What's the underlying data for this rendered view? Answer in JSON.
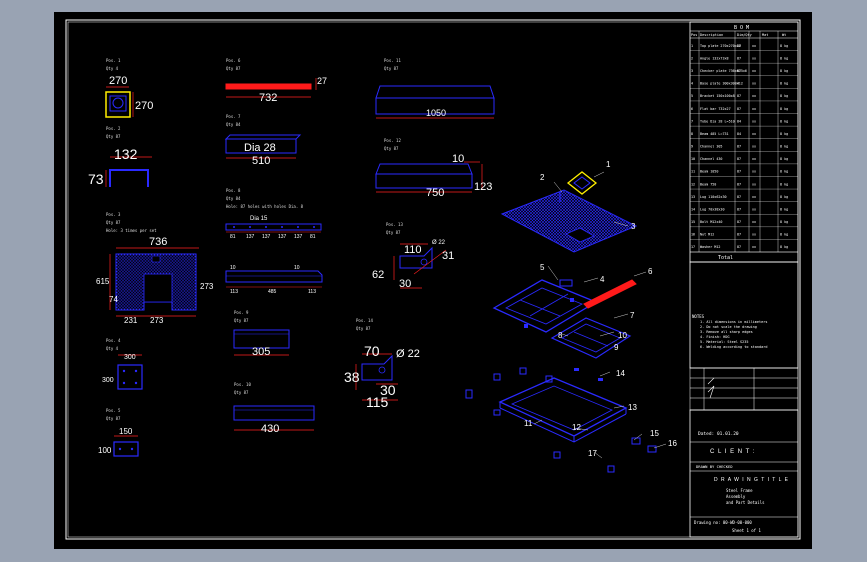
{
  "colors": {
    "background": "#000000",
    "border": "#ffffff",
    "part": "#1a1aff",
    "red": "#ff1a1a",
    "dim": "#ff2020",
    "yellow": "#ffee00",
    "text": "#ffffff"
  },
  "parts": {
    "p1": {
      "name": "Pos. 1",
      "qty": "Qty 4",
      "w": "270",
      "h": "270"
    },
    "p2": {
      "name": "Pos. 2",
      "qty": "Qty 87",
      "w": "132",
      "h": "73"
    },
    "p3": {
      "name": "Pos. 3",
      "qty": "Qty 87",
      "note": "Hole: 3 times per set",
      "w": "736",
      "h": "615",
      "d1": "273",
      "d2": "74",
      "d3": "231",
      "d4": "273"
    },
    "p4": {
      "name": "Pos. 4",
      "qty": "Qty 4",
      "w": "300",
      "h": "300"
    },
    "p5": {
      "name": "Pos. 5",
      "qty": "Qty 87",
      "w": "150",
      "h": "100"
    },
    "p6": {
      "name": "Pos. 6",
      "qty": "Qty 87",
      "len": "732",
      "thk": "27"
    },
    "p7": {
      "name": "Pos. 7",
      "qty": "Qty 84",
      "len": "510",
      "dia": "Dia 28"
    },
    "p8": {
      "name": "Pos. 8",
      "qty": "Qty 84",
      "note": "Hole: 87 holes with holes Dia. 8",
      "dia": "Dia 15",
      "segs": [
        "81",
        "137",
        "137",
        "137",
        "137",
        "81"
      ],
      "b1": "10",
      "b2": "10",
      "c1": "113",
      "c2": "485",
      "c3": "113"
    },
    "p9": {
      "name": "Pos. 9",
      "qty": "Qty 87",
      "len": "305"
    },
    "p10": {
      "name": "Pos. 10",
      "qty": "Qty 87",
      "len": "430"
    },
    "p11": {
      "name": "Pos. 11",
      "qty": "Qty 87",
      "len": "1050"
    },
    "p12": {
      "name": "Pos. 12",
      "qty": "Qty 87",
      "len": "750",
      "h1": "10",
      "h2": "123"
    },
    "p13": {
      "name": "Pos. 13",
      "qty": "Qty 87",
      "a": "110",
      "b": "62",
      "c": "30",
      "d": "31",
      "dia": "Ø 22"
    },
    "p14": {
      "name": "Pos. 14",
      "qty": "Qty 87",
      "a": "70",
      "b": "38",
      "c": "30",
      "d": "115",
      "dia": "Ø 22"
    }
  },
  "balloons": [
    "1",
    "2",
    "3",
    "4",
    "5",
    "6",
    "7",
    "8",
    "9",
    "10",
    "11",
    "12",
    "13",
    "14",
    "15",
    "16",
    "17"
  ],
  "bom": {
    "title": "B O M",
    "headers": [
      "Pos",
      "Description",
      "Dim/Qty",
      "Mat",
      "Wt"
    ],
    "rows": [
      [
        "1",
        "Top plate 270x270x10",
        "87",
        "xx",
        "8 kg"
      ],
      [
        "2",
        "Angle 132x73x8",
        "87",
        "xx",
        "8 kg"
      ],
      [
        "3",
        "Checker plate 736x615x6",
        "87",
        "xx",
        "8 kg"
      ],
      [
        "4",
        "Base plate 300x300x12",
        "4",
        "xx",
        "8 kg"
      ],
      [
        "5",
        "Bracket 150x100x8",
        "87",
        "xx",
        "8 kg"
      ],
      [
        "6",
        "Flat bar 732x27",
        "87",
        "xx",
        "8 kg"
      ],
      [
        "7",
        "Tube Dia 28 L=510",
        "84",
        "xx",
        "8 kg"
      ],
      [
        "8",
        "Beam 485 L=731",
        "84",
        "xx",
        "8 kg"
      ],
      [
        "9",
        "Channel 305",
        "87",
        "xx",
        "8 kg"
      ],
      [
        "10",
        "Channel 430",
        "87",
        "xx",
        "8 kg"
      ],
      [
        "11",
        "Beam 1050",
        "87",
        "xx",
        "8 kg"
      ],
      [
        "12",
        "Beam 750",
        "87",
        "xx",
        "8 kg"
      ],
      [
        "13",
        "Lug 110x62x30",
        "87",
        "xx",
        "8 kg"
      ],
      [
        "14",
        "Lug 70x38x30",
        "87",
        "xx",
        "8 kg"
      ],
      [
        "15",
        "Bolt M12x40",
        "87",
        "xx",
        "8 kg"
      ],
      [
        "16",
        "Nut M12",
        "87",
        "xx",
        "8 kg"
      ],
      [
        "17",
        "Washer M12",
        "87",
        "xx",
        "8 kg"
      ]
    ],
    "total": "Total"
  },
  "notes": {
    "title": "NOTES",
    "items": [
      "1. All dimensions in millimeters",
      "2. Do not scale the drawing",
      "3. Remove all sharp edges",
      "4. Finish: HDG",
      "5. Material: Steel S235",
      "6. Welding according to standard"
    ]
  },
  "title_block": {
    "date": "Dated: 01.01.20",
    "client_label": "C L I E N T :",
    "designed_by": "DRAWN BY  CHECKED",
    "title_label": "D R A W I N G   T I T L E",
    "title_line1": "Steel Frame",
    "title_line2": "Assembly",
    "title_line3": "and Part Details",
    "drawing_no": "Drawing no: 00-WD-00-000",
    "sheet": "Sheet 1 of 1"
  }
}
